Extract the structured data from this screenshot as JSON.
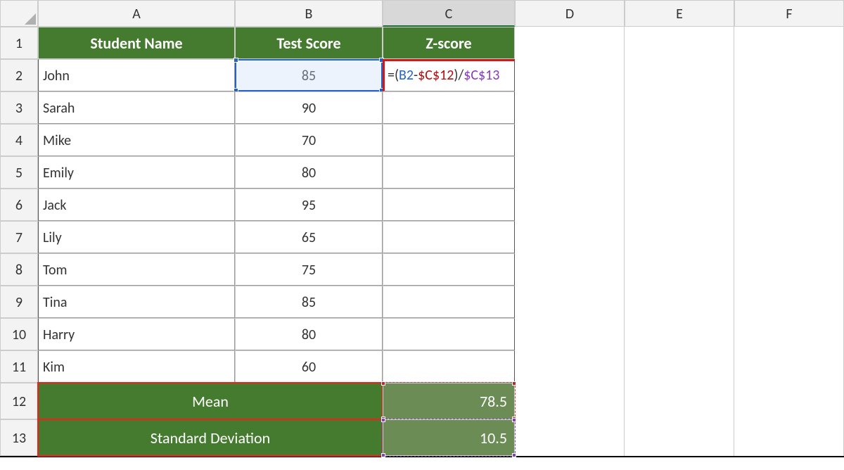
{
  "columns": [
    "A",
    "B",
    "C",
    "D",
    "E",
    "F"
  ],
  "rows": [
    "1",
    "2",
    "3",
    "4",
    "5",
    "6",
    "7",
    "8",
    "9",
    "10",
    "11",
    "12",
    "13"
  ],
  "headers": {
    "A": "Student Name",
    "B": "Test Score",
    "C": "Z-score"
  },
  "data": [
    {
      "name": "John",
      "score": "85"
    },
    {
      "name": "Sarah",
      "score": "90"
    },
    {
      "name": "Mike",
      "score": "70"
    },
    {
      "name": "Emily",
      "score": "80"
    },
    {
      "name": "Jack",
      "score": "95"
    },
    {
      "name": "Lily",
      "score": "65"
    },
    {
      "name": "Tom",
      "score": "75"
    },
    {
      "name": "Tina",
      "score": "85"
    },
    {
      "name": "Harry",
      "score": "80"
    },
    {
      "name": "Kim",
      "score": "60"
    }
  ],
  "stats": {
    "mean_label": "Mean",
    "mean_value": "78.5",
    "std_label": "Standard Deviation",
    "std_value": "10.5"
  },
  "formula": {
    "full": "=(B2-$C$12)/$C$13",
    "p0": "=(",
    "p1": "B2",
    "p2": "-",
    "p3": "$C$12",
    "p4": ")/",
    "p5": "$C$13"
  },
  "chart_data": {
    "type": "table",
    "title": "Student Test Scores with Z-score calculation",
    "columns": [
      "Student Name",
      "Test Score",
      "Z-score"
    ],
    "rows": [
      [
        "John",
        85,
        null
      ],
      [
        "Sarah",
        90,
        null
      ],
      [
        "Mike",
        70,
        null
      ],
      [
        "Emily",
        80,
        null
      ],
      [
        "Jack",
        95,
        null
      ],
      [
        "Lily",
        65,
        null
      ],
      [
        "Tom",
        75,
        null
      ],
      [
        "Tina",
        85,
        null
      ],
      [
        "Harry",
        80,
        null
      ],
      [
        "Kim",
        60,
        null
      ]
    ],
    "summary": {
      "Mean": 78.5,
      "Standard Deviation": 10.5
    },
    "formula_in_C2": "=(B2-$C$12)/$C$13"
  }
}
